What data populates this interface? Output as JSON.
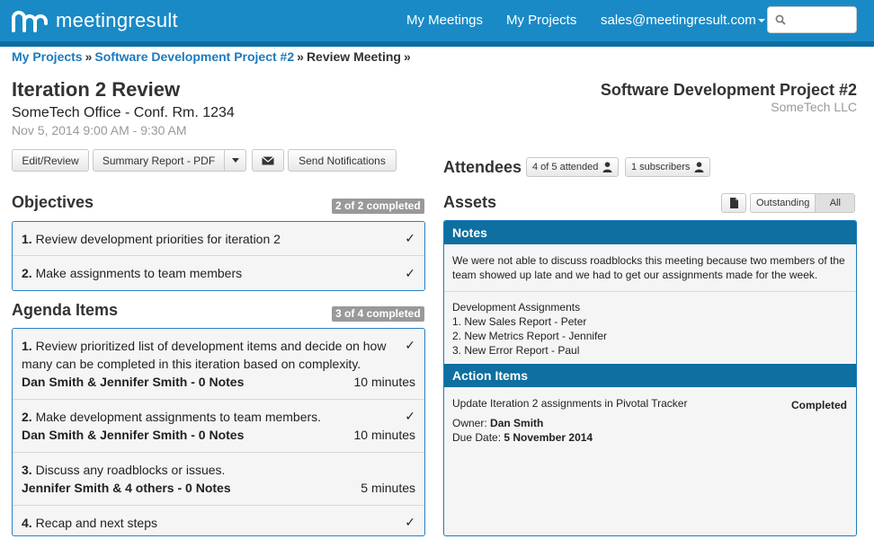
{
  "app": {
    "brand": "meetingresult",
    "nav": {
      "my_meetings": "My Meetings",
      "my_projects": "My Projects",
      "account": "sales@meetingresult.com"
    },
    "search": {
      "placeholder": "",
      "value": ""
    },
    "colors": {
      "topbar": "#1a8ac6",
      "panel_header": "#0e6fa0",
      "link": "#1a7bbf"
    }
  },
  "breadcrumb": {
    "items": [
      "My Projects",
      "Software Development Project #2",
      "Review Meeting"
    ],
    "separator": "»"
  },
  "meeting": {
    "title": "Iteration 2 Review",
    "location": "SomeTech Office - Conf. Rm. 1234",
    "time": "Nov 5, 2014 9:00 AM - 9:30 AM"
  },
  "project": {
    "title": "Software Development Project #2",
    "company": "SomeTech LLC"
  },
  "toolbar": {
    "edit_review": "Edit/Review",
    "summary_report": "Summary Report - PDF",
    "send_notifications": "Send Notifications"
  },
  "objectives": {
    "heading": "Objectives",
    "badge": "2 of 2 completed",
    "items": [
      {
        "num": "1.",
        "text": "Review development priorities for iteration 2",
        "check": "✓"
      },
      {
        "num": "2.",
        "text": "Make assignments to team members",
        "check": "✓"
      }
    ]
  },
  "agenda": {
    "heading": "Agenda Items",
    "badge": "3 of 4 completed",
    "items": [
      {
        "num": "1.",
        "text": "Review prioritized list of development items and decide on how many can be completed in this iteration based on complexity.",
        "who": "Dan Smith & Jennifer Smith - 0 Notes",
        "duration": "10 minutes",
        "check": "✓"
      },
      {
        "num": "2.",
        "text": "Make development assignments to team members.",
        "who": "Dan Smith & Jennifer Smith - 0 Notes",
        "duration": "10 minutes",
        "check": "✓"
      },
      {
        "num": "3.",
        "text": "Discuss any roadblocks or issues.",
        "who": "Jennifer Smith & 4 others - 0 Notes",
        "duration": "5 minutes",
        "check": ""
      },
      {
        "num": "4.",
        "text": "Recap and next steps",
        "who": "",
        "duration": "",
        "check": "✓"
      }
    ]
  },
  "attendees": {
    "heading": "Attendees",
    "attended": "4 of 5 attended",
    "subscribers": "1 subscribers"
  },
  "assets": {
    "heading": "Assets",
    "filter": {
      "outstanding": "Outstanding",
      "all": "All",
      "selected": "All"
    },
    "notes": {
      "header": "Notes",
      "paragraph": "We were not able to discuss roadblocks this meeting because two members of the team showed up late and we had to get our assignments made for the week.",
      "list_title": "Development Assignments",
      "list": [
        "1. New Sales Report - Peter",
        "2. New Metrics Report - Jennifer",
        "3. New Error Report - Paul"
      ]
    },
    "action_items": {
      "header": "Action Items",
      "items": [
        {
          "title": "Update Iteration 2 assignments in Pivotal Tracker",
          "status": "Completed",
          "owner_label": "Owner:",
          "owner": "Dan Smith",
          "due_label": "Due Date:",
          "due": "5 November 2014"
        }
      ]
    }
  }
}
